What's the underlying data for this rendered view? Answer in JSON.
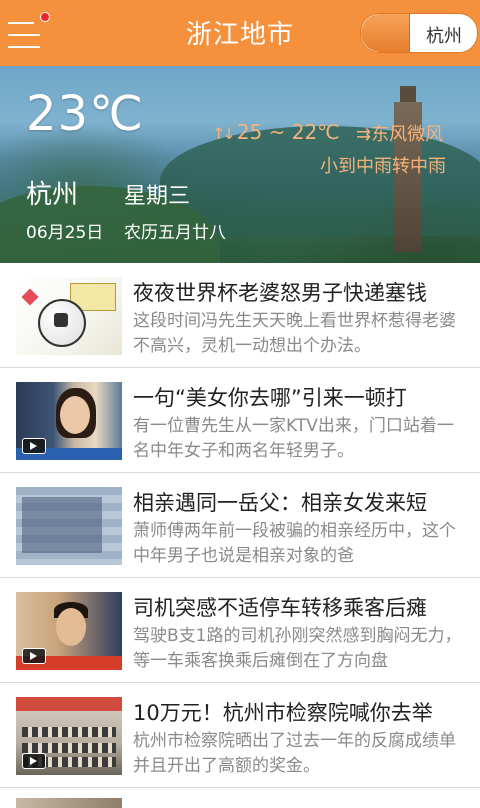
{
  "header": {
    "title": "浙江地市",
    "city_button": "杭州"
  },
  "weather": {
    "temperature": "23℃",
    "range": "25 ~ 22℃",
    "wind": "东风微风",
    "condition": "小到中雨转中雨",
    "city": "杭州",
    "weekday": "星期三",
    "date": "06月25日",
    "lunar_date": "农历五月廿八"
  },
  "news": [
    {
      "title": "夜夜世界杯老婆怒男子快递塞钱",
      "summary": "这段时间冯先生天天晚上看世界杯惹得老婆不高兴，灵机一动想出个办法。",
      "video": false
    },
    {
      "title": "一句“美女你去哪”引来一顿打",
      "summary": "有一位曹先生从一家KTV出来，门口站着一名中年女子和两名年轻男子。",
      "video": true
    },
    {
      "title": "相亲遇同一岳父：相亲女发来短",
      "summary": "萧师傅两年前一段被骗的相亲经历中，这个中年男子也说是相亲对象的爸",
      "video": false
    },
    {
      "title": "司机突感不适停车转移乘客后瘫",
      "summary": "驾驶B支1路的司机孙刚突然感到胸闷无力，等一车乘客换乘后瘫倒在了方向盘",
      "video": true
    },
    {
      "title": "10万元！杭州市检察院喊你去举",
      "summary": "杭州市检察院晒出了过去一年的反腐成绩单并且开出了高额的奖金。",
      "video": true
    }
  ],
  "colors": {
    "header_bg": "#f5913c",
    "accent_text": "#f6b27a",
    "title_text": "#222222",
    "summary_text": "#8a8a8a"
  },
  "icons": {
    "menu": "menu-icon",
    "notification": "notification-dot",
    "video": "video-play-icon",
    "temperature_range": "up-down-arrow-icon"
  }
}
